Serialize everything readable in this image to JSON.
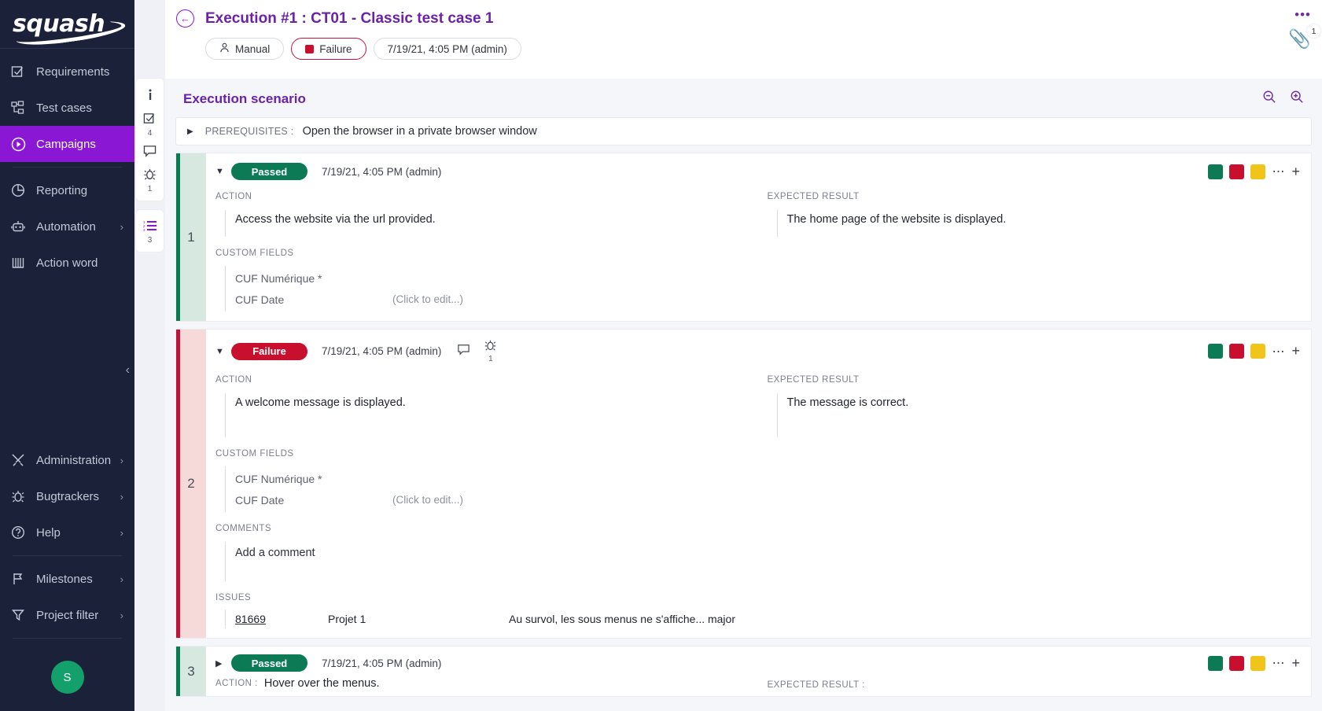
{
  "sidebar": {
    "logo": "squash",
    "items": [
      {
        "label": "Requirements",
        "icon": "checklist-icon",
        "chevron": false,
        "active": false
      },
      {
        "label": "Test cases",
        "icon": "hierarchy-icon",
        "chevron": false,
        "active": false
      },
      {
        "label": "Campaigns",
        "icon": "play-circle-icon",
        "chevron": false,
        "active": true
      },
      {
        "label": "Reporting",
        "icon": "pie-chart-icon",
        "chevron": false,
        "active": false
      },
      {
        "label": "Automation",
        "icon": "robot-icon",
        "chevron": true,
        "active": false
      },
      {
        "label": "Action word",
        "icon": "book-icon",
        "chevron": false,
        "active": false
      }
    ],
    "bottom_items": [
      {
        "label": "Administration",
        "icon": "tools-icon",
        "chevron": true
      },
      {
        "label": "Bugtrackers",
        "icon": "bug-icon",
        "chevron": true
      },
      {
        "label": "Help",
        "icon": "question-circle-icon",
        "chevron": true
      },
      {
        "label": "Milestones",
        "icon": "flag-icon",
        "chevron": true
      },
      {
        "label": "Project filter",
        "icon": "funnel-icon",
        "chevron": true
      }
    ],
    "avatar_initial": "S",
    "collapse_glyph": "‹"
  },
  "rail": {
    "buttons": [
      {
        "name": "information-icon",
        "glyph": "i",
        "badge": ""
      },
      {
        "name": "checklist-icon",
        "glyph": "☑",
        "badge": "4"
      },
      {
        "name": "comment-icon",
        "glyph": "▭",
        "badge": ""
      },
      {
        "name": "bug-icon",
        "glyph": "☢",
        "badge": "1"
      }
    ],
    "selected": {
      "name": "steps-list-icon",
      "glyph": "☰",
      "badge": "3"
    }
  },
  "header": {
    "back_glyph": "←",
    "title": "Execution #1 : CT01 - Classic test case 1",
    "chips": [
      {
        "label": "Manual",
        "icon": "person-icon",
        "type": "mode"
      },
      {
        "label": "Failure",
        "icon": "status-square",
        "type": "status",
        "color": "#c8102e"
      },
      {
        "label": "7/19/21, 4:05 PM (admin)",
        "icon": "",
        "type": "date"
      }
    ],
    "menu_glyph": "•••",
    "attachment_icon": "paperclip-icon",
    "attachment_count": "1"
  },
  "scenario": {
    "title": "Execution scenario",
    "zoom_out_icon": "zoom-out-icon",
    "zoom_in_icon": "zoom-in-icon",
    "prerequisites": {
      "label": "PREREQUISITES :",
      "text": "Open the browser in a private browser window"
    },
    "labels": {
      "action": "ACTION",
      "expected": "EXPECTED RESULT",
      "custom_fields": "CUSTOM FIELDS",
      "comments": "COMMENTS",
      "issues": "ISSUES",
      "action_inline": "ACTION :",
      "expected_inline": "EXPECTED RESULT :"
    },
    "steps": [
      {
        "number": "1",
        "status": "Passed",
        "status_kind": "passed",
        "date": "7/19/21, 4:05 PM (admin)",
        "expanded": true,
        "action": "Access the website via the url provided.",
        "expected": "The home page of the website is displayed.",
        "custom_fields": [
          {
            "name": "CUF Numérique *",
            "value": ""
          },
          {
            "name": "CUF Date",
            "value": "(Click to edit...)"
          }
        ],
        "head_icons": [],
        "comments": null,
        "issues": []
      },
      {
        "number": "2",
        "status": "Failure",
        "status_kind": "failed",
        "date": "7/19/21, 4:05 PM (admin)",
        "expanded": true,
        "action": "A welcome message is displayed.",
        "expected": "The message is correct.",
        "custom_fields": [
          {
            "name": "CUF Numérique *",
            "value": ""
          },
          {
            "name": "CUF Date",
            "value": "(Click to edit...)"
          }
        ],
        "head_icons": [
          {
            "name": "comment-icon",
            "glyph": "▭",
            "badge": ""
          },
          {
            "name": "bug-icon",
            "glyph": "☢",
            "badge": "1"
          }
        ],
        "comments": "Add a comment",
        "issues": [
          {
            "id": "81669",
            "project": "Projet 1",
            "summary": "Au survol, les sous menus ne s'affiche... major"
          }
        ]
      },
      {
        "number": "3",
        "status": "Passed",
        "status_kind": "passed",
        "date": "7/19/21, 4:05 PM (admin)",
        "expanded": false,
        "action": "Hover over the menus.",
        "expected": "",
        "custom_fields": [],
        "head_icons": [],
        "comments": null,
        "issues": []
      }
    ]
  },
  "colors": {
    "brand_purple": "#8a17d4",
    "title_purple": "#6b21a8",
    "passed_green": "#0b7a55",
    "failed_red": "#c8102e",
    "warn_yellow": "#f0c419",
    "sidebar_bg": "#1b2138"
  }
}
